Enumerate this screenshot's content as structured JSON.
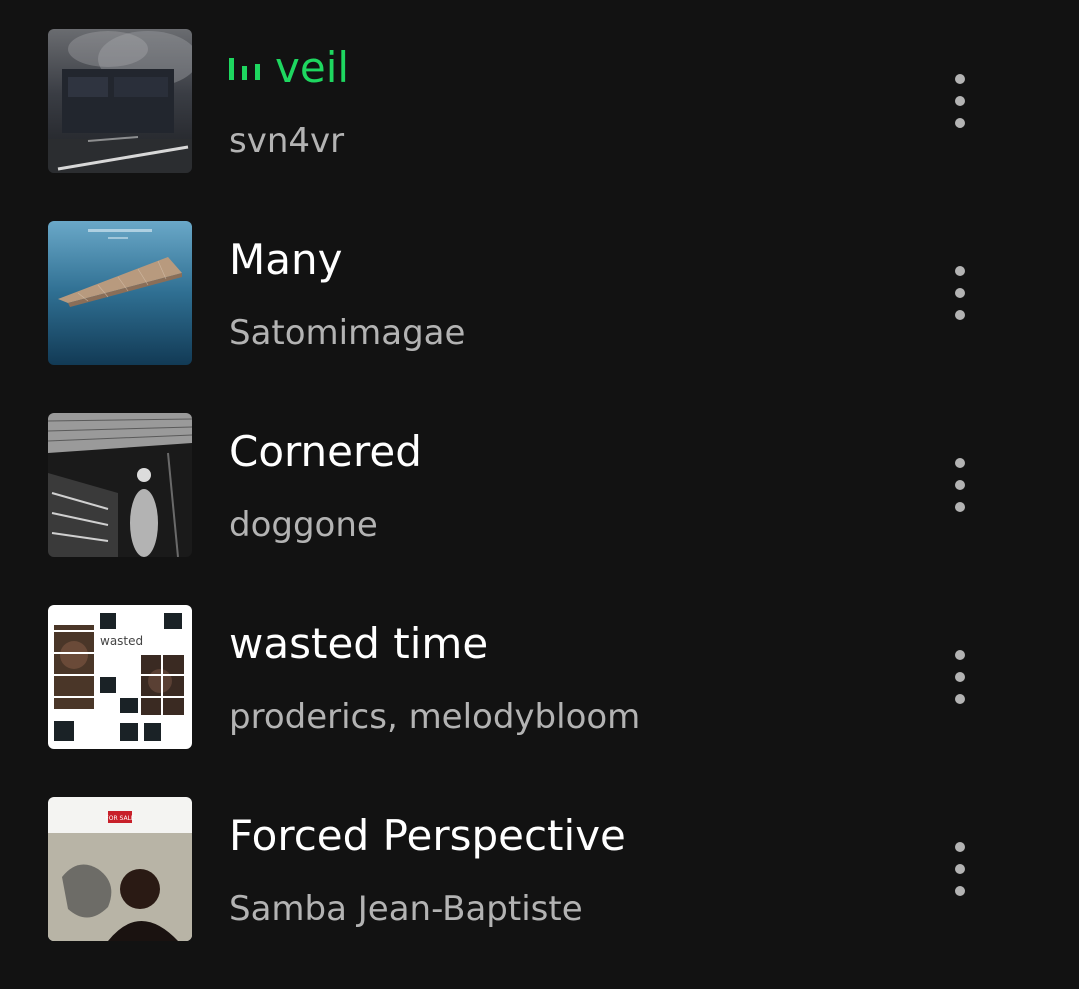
{
  "accent_color": "#1ed760",
  "tracks": [
    {
      "title": "veil",
      "artist": "svn4vr",
      "playing": true,
      "playing_icon": "equalizer-icon",
      "more_icon": "more-vertical-icon"
    },
    {
      "title": "Many",
      "artist": "Satomimagae",
      "playing": false,
      "more_icon": "more-vertical-icon"
    },
    {
      "title": "Cornered",
      "artist": "doggone",
      "playing": false,
      "more_icon": "more-vertical-icon"
    },
    {
      "title": "wasted time",
      "artist": "proderics, melodybloom",
      "playing": false,
      "cover_text": "wasted",
      "more_icon": "more-vertical-icon"
    },
    {
      "title": "Forced Perspective",
      "artist": "Samba Jean-Baptiste",
      "playing": false,
      "cover_text": "FOR SALE",
      "more_icon": "more-vertical-icon"
    }
  ]
}
